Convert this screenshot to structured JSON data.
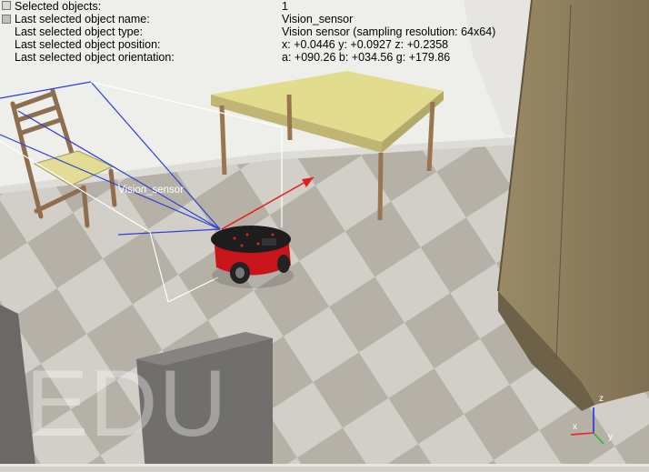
{
  "app": {
    "watermark": "EDU"
  },
  "info_panel": {
    "rows": [
      {
        "label": "Selected objects:",
        "value": "1"
      },
      {
        "label": "Last selected object name:",
        "value": "Vision_sensor"
      },
      {
        "label": "Last selected object type:",
        "value": "Vision sensor (sampling resolution: 64x64)"
      },
      {
        "label": "Last selected object position:",
        "value": "x: +0.0446   y: +0.0927   z: +0.2358"
      },
      {
        "label": "Last selected object orientation:",
        "value": "a: +090.26   b: +034.56   g: +179.86"
      }
    ]
  },
  "scene": {
    "sensor_label": "Vision_sensor",
    "axis_labels": {
      "x": "x",
      "y": "y",
      "z": "z"
    }
  },
  "colors": {
    "frustum": "#2d3fd8",
    "sensor_arrow": "#e0201c",
    "robot_body": "#c8151a",
    "table_top": "#e2dc8e",
    "wall": "#8b7c5c"
  }
}
